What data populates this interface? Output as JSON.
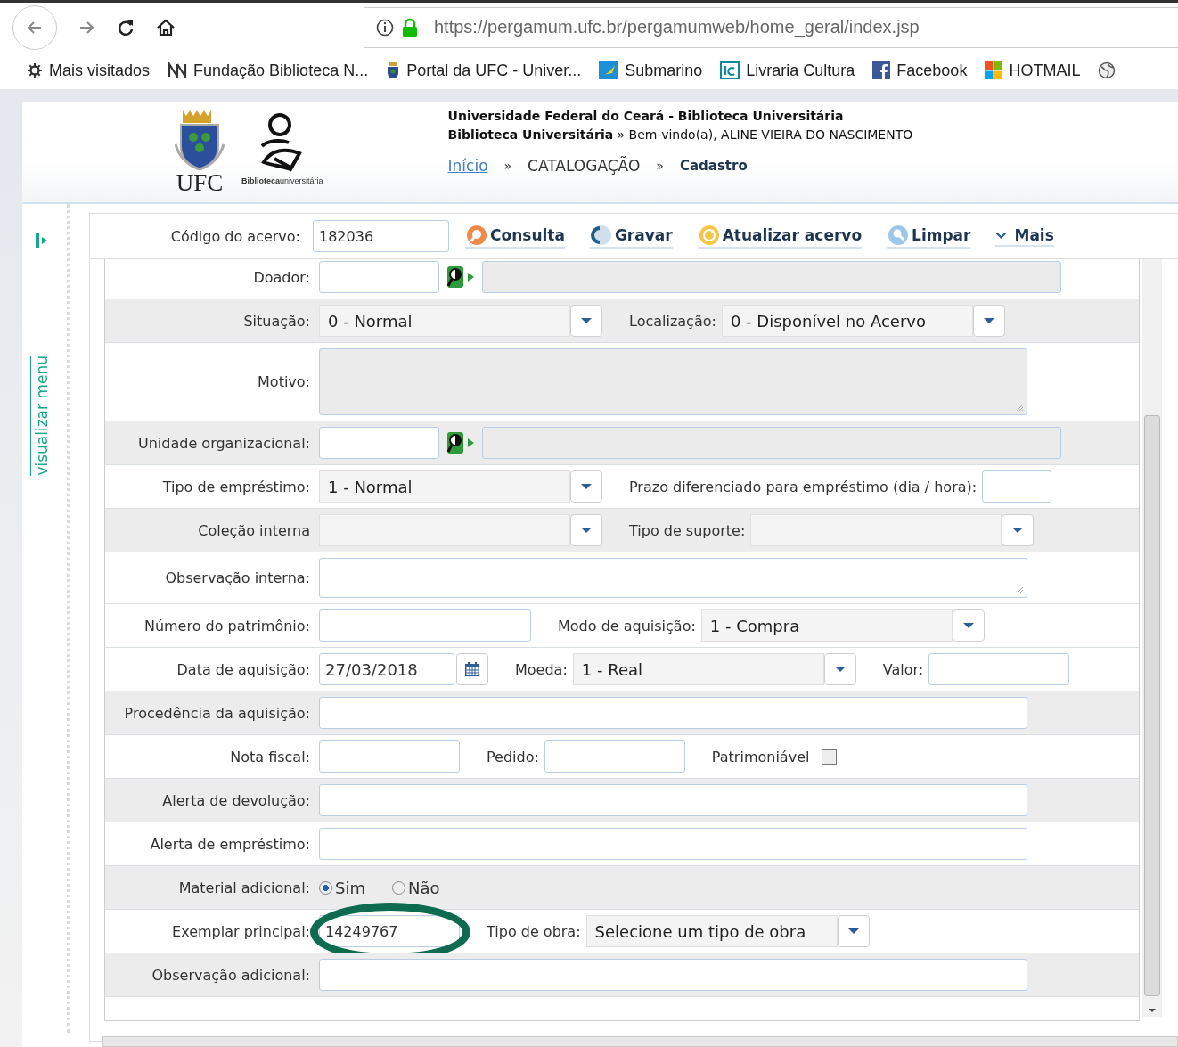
{
  "browser": {
    "url": "https://pergamum.ufc.br/pergamumweb/home_geral/index.jsp",
    "bookmarks": [
      {
        "label": "Mais visitados",
        "kind": "gear"
      },
      {
        "label": "Fundação Biblioteca N...",
        "kind": "emblem"
      },
      {
        "label": "Portal da UFC - Univer...",
        "kind": "crest"
      },
      {
        "label": "Submarino",
        "kind": "submarino"
      },
      {
        "label": "Livraria Cultura",
        "kind": "lc"
      },
      {
        "label": "Facebook",
        "kind": "facebook"
      },
      {
        "label": "HOTMAIL",
        "kind": "windows"
      }
    ]
  },
  "header": {
    "logo_text": "UFC",
    "library_logo_text": "**Biblioteca**universitária",
    "title": "Universidade Federal do Ceará - Biblioteca Universitária",
    "subtitle": "**Biblioteca Universitária** » Bem-vindo(a), ALINE VIEIRA DO NASCIMENTO",
    "breadcrumb": [
      {
        "label": "Início",
        "kind": "link"
      },
      {
        "label": "»",
        "kind": "separator"
      },
      {
        "label": "CATALOGAÇÃO",
        "kind": "text"
      },
      {
        "label": "»",
        "kind": "separator"
      },
      {
        "label": "Cadastro",
        "kind": "current"
      }
    ]
  },
  "sidebar": {
    "label": "visualizar menu"
  },
  "toolbar": {
    "label": "Código do acervo:",
    "value": "182036",
    "buttons": [
      {
        "label": "Consulta",
        "kind": "search"
      },
      {
        "label": "Gravar",
        "kind": "save"
      },
      {
        "label": "Atualizar acervo",
        "kind": "refresh"
      },
      {
        "label": "Limpar",
        "kind": "clear"
      },
      {
        "label": "Mais",
        "kind": "more"
      }
    ]
  },
  "form": {
    "rows": [
      {
        "label": "Doador:",
        "shaded": false,
        "circled": false,
        "controls": [
          {
            "kind": "lookup"
          }
        ]
      },
      {
        "label": "Situação:",
        "shaded": true,
        "circled": false,
        "controls": [
          {
            "kind": "select",
            "value": "0 - Normal"
          },
          {
            "kind": "label",
            "text": "Localização:"
          },
          {
            "kind": "select",
            "value": "0 - Disponível no Acervo"
          }
        ]
      },
      {
        "label": "Motivo:",
        "shaded": false,
        "circled": false,
        "controls": [
          {
            "kind": "textarea",
            "disabled": true
          }
        ]
      },
      {
        "label": "Unidade organizacional:",
        "shaded": true,
        "circled": false,
        "controls": [
          {
            "kind": "lookup"
          }
        ]
      },
      {
        "label": "Tipo de empréstimo:",
        "shaded": false,
        "circled": false,
        "controls": [
          {
            "kind": "select",
            "value": "1 - Normal"
          },
          {
            "kind": "label",
            "text": "Prazo diferenciado para empréstimo (dia / hora):"
          },
          {
            "kind": "small"
          }
        ]
      },
      {
        "label": "Coleção interna",
        "shaded": true,
        "circled": false,
        "controls": [
          {
            "kind": "select"
          },
          {
            "kind": "label",
            "text": "Tipo de suporte:"
          },
          {
            "kind": "select"
          }
        ]
      },
      {
        "label": "Observação interna:",
        "shaded": false,
        "circled": false,
        "controls": [
          {
            "kind": "textarea",
            "disabled": false
          }
        ]
      },
      {
        "label": "Número do patrimônio:",
        "shaded": false,
        "circled": false,
        "controls": [
          {
            "kind": "medium"
          },
          {
            "kind": "label",
            "text": "Modo de aquisição:"
          },
          {
            "kind": "select",
            "value": "1 - Compra"
          }
        ]
      },
      {
        "label": "Data de aquisição:",
        "shaded": false,
        "circled": false,
        "controls": [
          {
            "kind": "date",
            "value": "27/03/2018"
          },
          {
            "kind": "label",
            "text": "Moeda:"
          },
          {
            "kind": "select",
            "value": "1 - Real"
          },
          {
            "kind": "label",
            "text": "Valor:"
          },
          {
            "kind": "field"
          }
        ]
      },
      {
        "label": "Procedência da aquisição:",
        "shaded": true,
        "circled": false,
        "controls": [
          {
            "kind": "wide"
          }
        ]
      },
      {
        "label": "Nota fiscal:",
        "shaded": false,
        "circled": false,
        "controls": [
          {
            "kind": "field"
          },
          {
            "kind": "label",
            "text": "Pedido:"
          },
          {
            "kind": "field"
          },
          {
            "kind": "label",
            "text": "Patrimoniável"
          },
          {
            "kind": "checkbox",
            "checked": false
          }
        ]
      },
      {
        "label": "Alerta de devolução:",
        "shaded": true,
        "circled": false,
        "controls": [
          {
            "kind": "wide"
          }
        ]
      },
      {
        "label": "Alerta de empréstimo:",
        "shaded": false,
        "circled": false,
        "controls": [
          {
            "kind": "wide"
          }
        ]
      },
      {
        "label": "Material adicional:",
        "shaded": true,
        "circled": false,
        "controls": [
          {
            "kind": "radio",
            "options": [
              {
                "label": "Sim",
                "selected": true
              },
              {
                "label": "Não",
                "selected": false
              }
            ]
          }
        ]
      },
      {
        "label": "Exemplar principal:",
        "shaded": false,
        "circled": true,
        "controls": [
          {
            "kind": "field",
            "value": "14249767"
          },
          {
            "kind": "label",
            "text": "Tipo de obra:"
          },
          {
            "kind": "select",
            "value": "Selecione um tipo de obra"
          }
        ]
      },
      {
        "label": "Observação adicional:",
        "shaded": true,
        "circled": false,
        "controls": [
          {
            "kind": "wide"
          }
        ]
      }
    ]
  }
}
